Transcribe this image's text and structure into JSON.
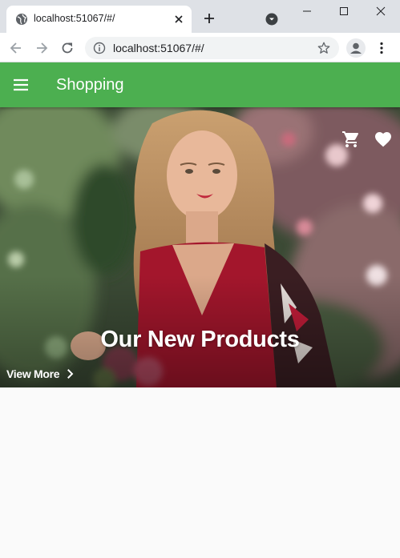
{
  "browser": {
    "tab_title": "localhost:51067/#/",
    "url": "localhost:51067/#/"
  },
  "icons": {
    "tab": "globe-icon",
    "tab_close": "close-icon",
    "new_tab": "plus-icon",
    "tab_search": "chevron-down-circle-icon",
    "minimize": "minimize-icon",
    "maximize": "maximize-icon",
    "close_window": "close-icon",
    "back": "arrow-left-icon",
    "forward": "arrow-right-icon",
    "reload": "reload-icon",
    "site_info": "info-icon",
    "bookmark": "star-icon",
    "profile": "account-icon",
    "browser_menu": "more-vert-icon",
    "app_menu": "menu-icon",
    "cart": "shopping-cart-icon",
    "favorite": "heart-icon",
    "view_more": "chevron-right-icon"
  },
  "app": {
    "title": "Shopping",
    "hero": {
      "title": "Our New Products",
      "view_more_label": "View More"
    }
  },
  "colors": {
    "app_bar": "#4caf50",
    "page_background": "#fafafa",
    "hero_text": "#ffffff"
  }
}
